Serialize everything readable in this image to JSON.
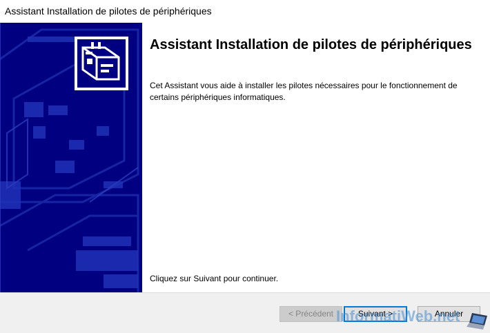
{
  "window": {
    "title": "Assistant Installation de pilotes de périphériques"
  },
  "wizard": {
    "heading": "Assistant Installation de pilotes de périphériques",
    "description": "Cet Assistant vous aide à installer les pilotes nécessaires pour le fonctionnement de certains périphériques informatiques.",
    "continue_text": "Cliquez sur Suivant pour continuer.",
    "banner_icon": "hardware-device-icon"
  },
  "buttons": {
    "previous_label": "< Précédent",
    "next_label": "Suivant >",
    "cancel_label": "Annuler"
  },
  "watermark": {
    "text": "InformatiWeb.net",
    "icon": "laptop-icon"
  },
  "colors": {
    "banner": "#000080",
    "footer": "#f0f0f0",
    "default_button_border": "#0078d7"
  }
}
